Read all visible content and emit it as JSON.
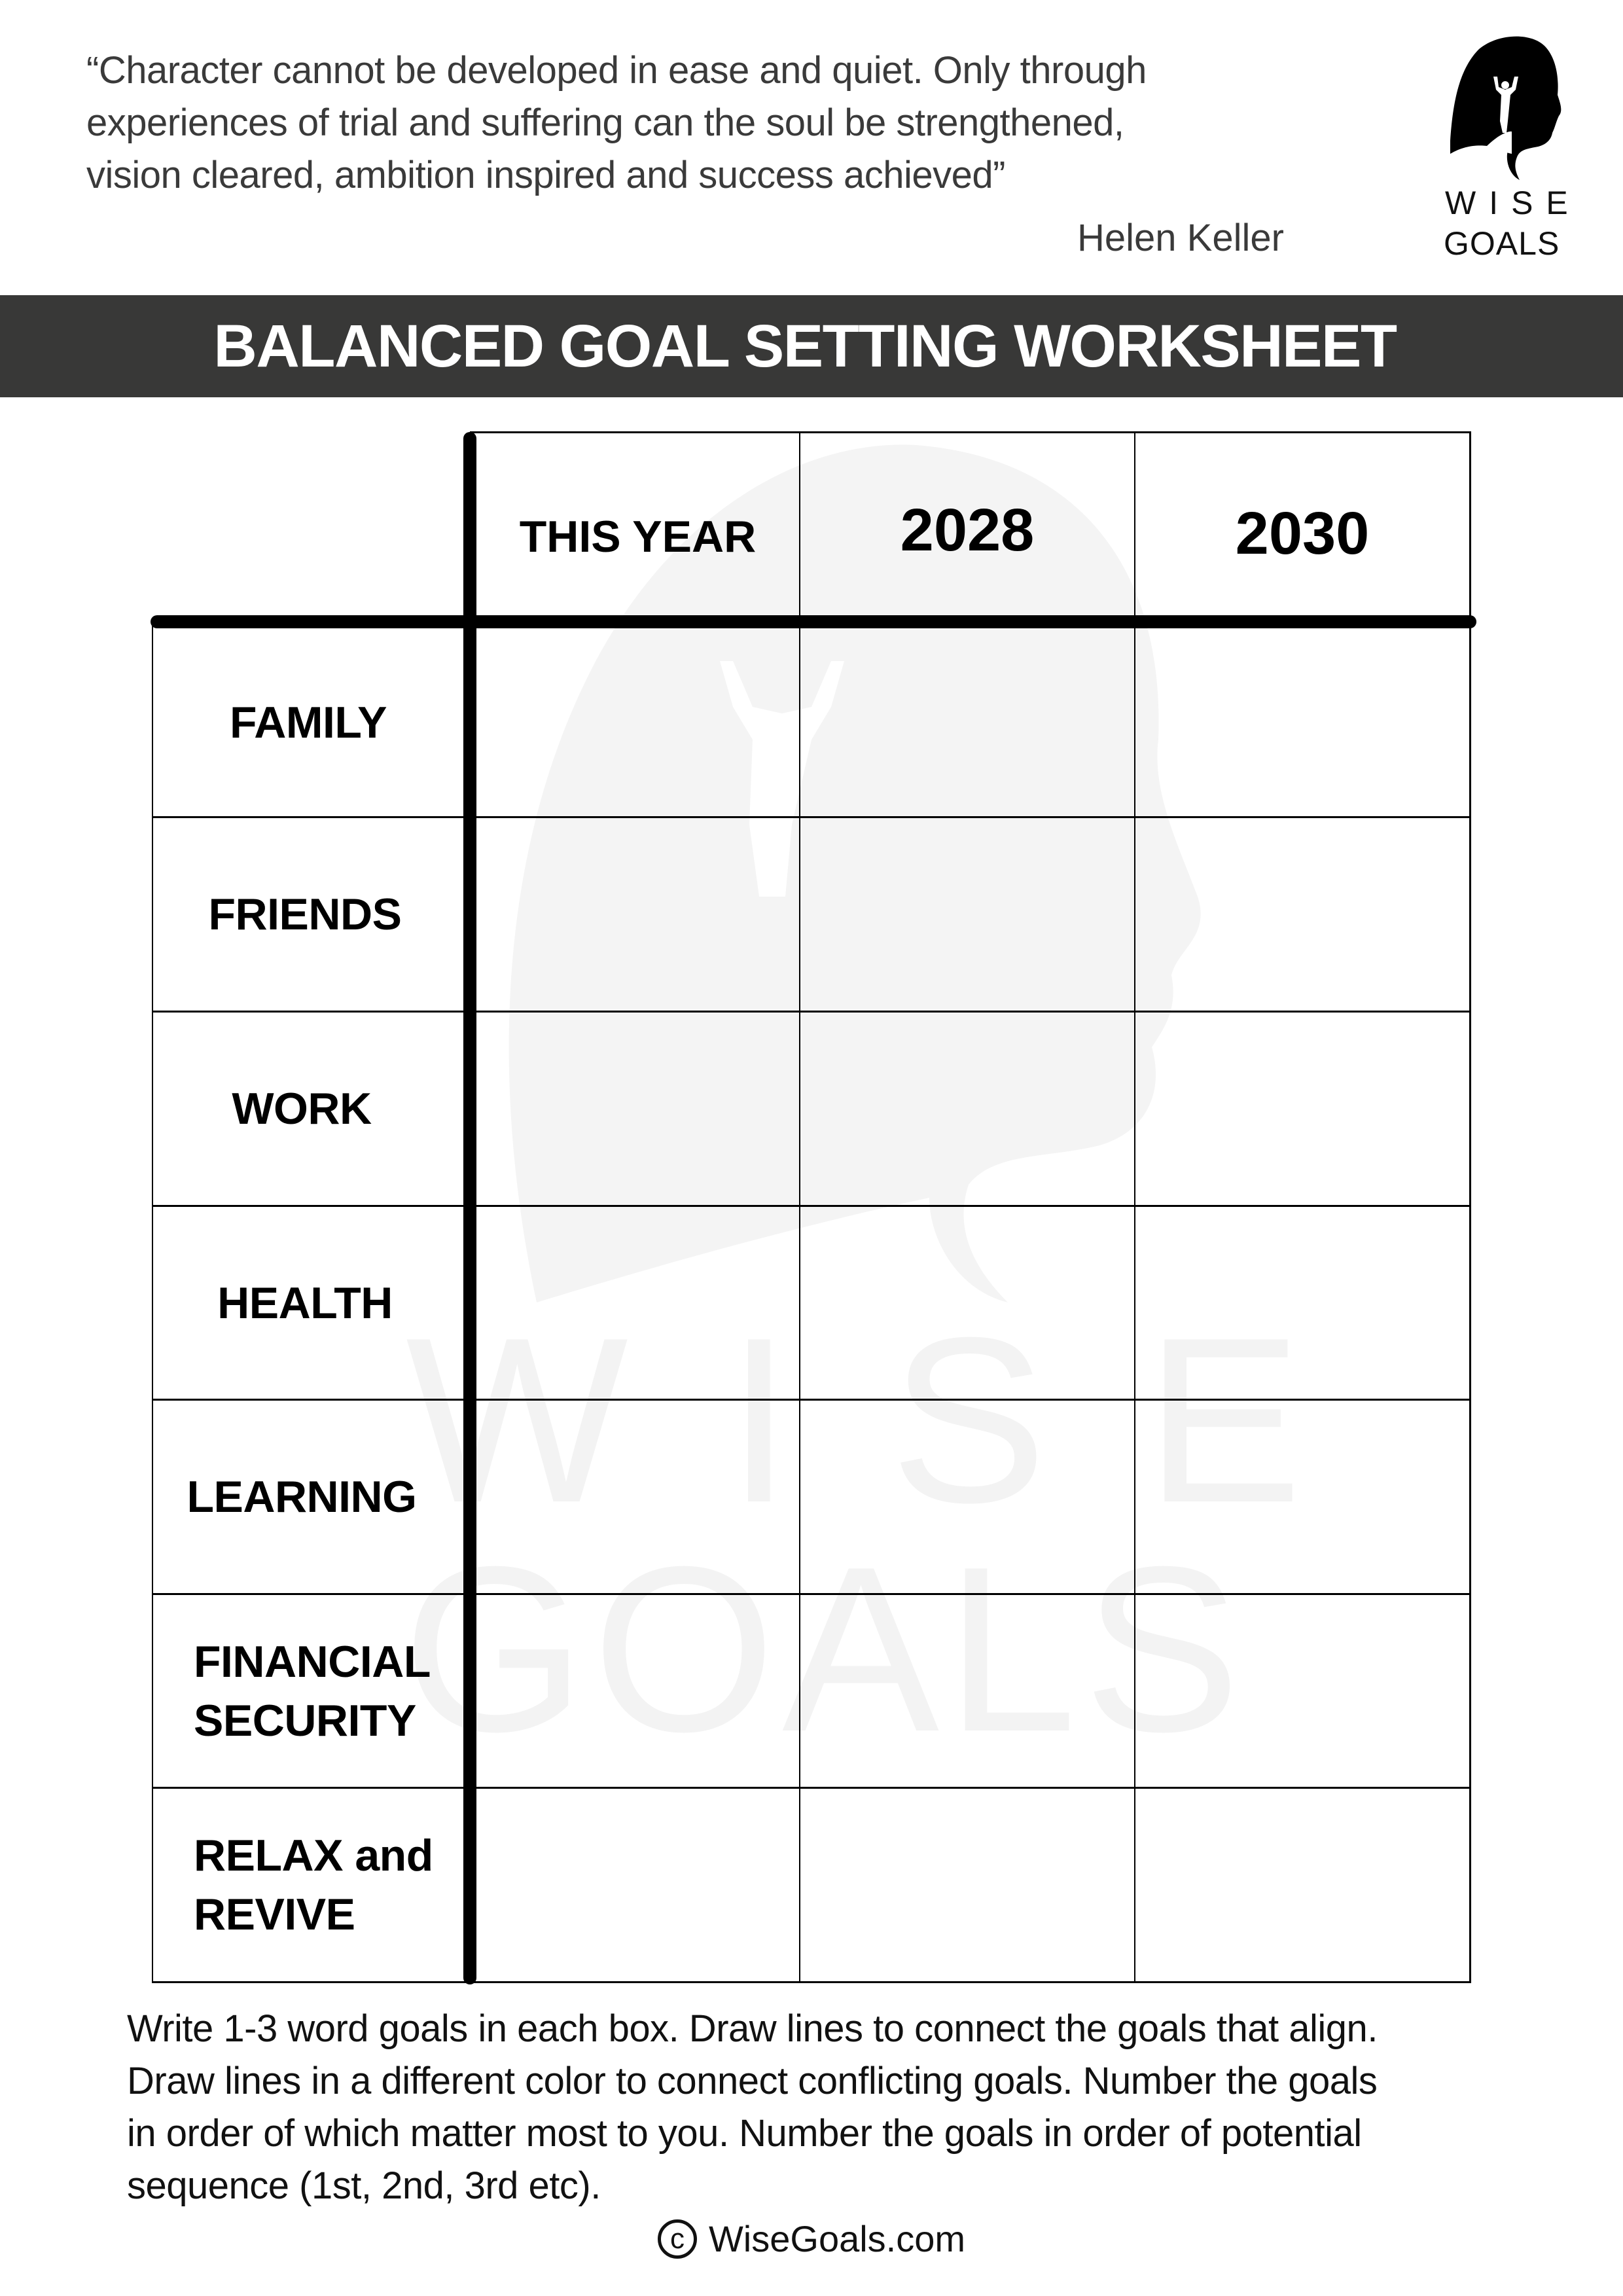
{
  "header": {
    "quote": "“Character cannot be developed in ease and quiet. Only through experiences of trial and suffering can the soul be strengthened, vision cleared, ambition inspired and success achieved”",
    "quote_lines": [
      "“Character cannot be developed in ease and quiet. Only through",
      "experiences of trial and suffering can the soul be strengthened,",
      "vision cleared, ambition inspired and success achieved”"
    ],
    "author": "Helen Keller",
    "logo": {
      "icon": "head-silhouette-with-climber-icon",
      "line1": "WISE",
      "line2": "GOALS"
    }
  },
  "banner": {
    "title": "BALANCED GOAL SETTING WORKSHEET",
    "background": "#383837",
    "text_color": "#ffffff"
  },
  "watermark": {
    "line1": "WISE",
    "line2": "GOALS",
    "icon": "head-silhouette-with-climber-icon"
  },
  "table": {
    "columns": [
      "THIS YEAR",
      "2028",
      "2030"
    ],
    "rows": [
      {
        "label": "FAMILY",
        "cells": [
          "",
          "",
          ""
        ]
      },
      {
        "label": "FRIENDS",
        "cells": [
          "",
          "",
          ""
        ]
      },
      {
        "label": "WORK",
        "cells": [
          "",
          "",
          ""
        ]
      },
      {
        "label": "HEALTH",
        "cells": [
          "",
          "",
          ""
        ]
      },
      {
        "label": "LEARNING",
        "cells": [
          "",
          "",
          ""
        ]
      },
      {
        "label": "FINANCIAL SECURITY",
        "label_lines": [
          "FINANCIAL",
          "SECURITY"
        ],
        "cells": [
          "",
          "",
          ""
        ]
      },
      {
        "label": "RELAX and REVIVE",
        "label_lines": [
          "RELAX and",
          "REVIVE"
        ],
        "cells": [
          "",
          "",
          ""
        ]
      }
    ]
  },
  "instructions": {
    "lines": [
      "Write 1-3 word goals in each box. Draw lines to connect the goals that align.",
      "Draw lines in a different color to connect conflicting goals. Number the goals",
      "in order of which matter most to you. Number the goals in order of potential",
      "sequence (1st, 2nd, 3rd etc)."
    ]
  },
  "footer": {
    "copyright_symbol": "c",
    "site": "WiseGoals.com"
  }
}
